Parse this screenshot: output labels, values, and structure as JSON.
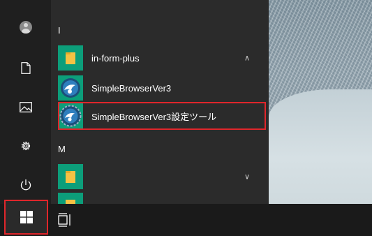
{
  "start_menu": {
    "rail": {
      "icons": [
        "user-avatar-icon",
        "document-icon",
        "pictures-icon",
        "settings-gear-icon",
        "power-icon"
      ]
    },
    "sections": [
      {
        "letter": "I",
        "items": [
          {
            "label": "in-form-plus",
            "icon": "folder-icon",
            "expandable": true,
            "expanded": true
          },
          {
            "label": "SimpleBrowserVer3",
            "icon": "simplebrowser-app-icon"
          },
          {
            "label": "SimpleBrowserVer3設定ツール",
            "icon": "simplebrowser-settings-icon",
            "highlighted": true
          }
        ]
      },
      {
        "letter": "M",
        "items": [
          {
            "label": "",
            "icon": "folder-icon",
            "expandable": true,
            "expanded": false
          }
        ]
      }
    ]
  },
  "taskbar": {
    "start_button_highlighted": true,
    "icons": [
      "windows-start-icon",
      "task-view-icon"
    ]
  },
  "colors": {
    "highlight": "#e0262b",
    "tile": "#0c9e7a",
    "panel": "#2b2b2b",
    "rail": "#1f1f1f",
    "taskbar": "#1a1a1a"
  }
}
